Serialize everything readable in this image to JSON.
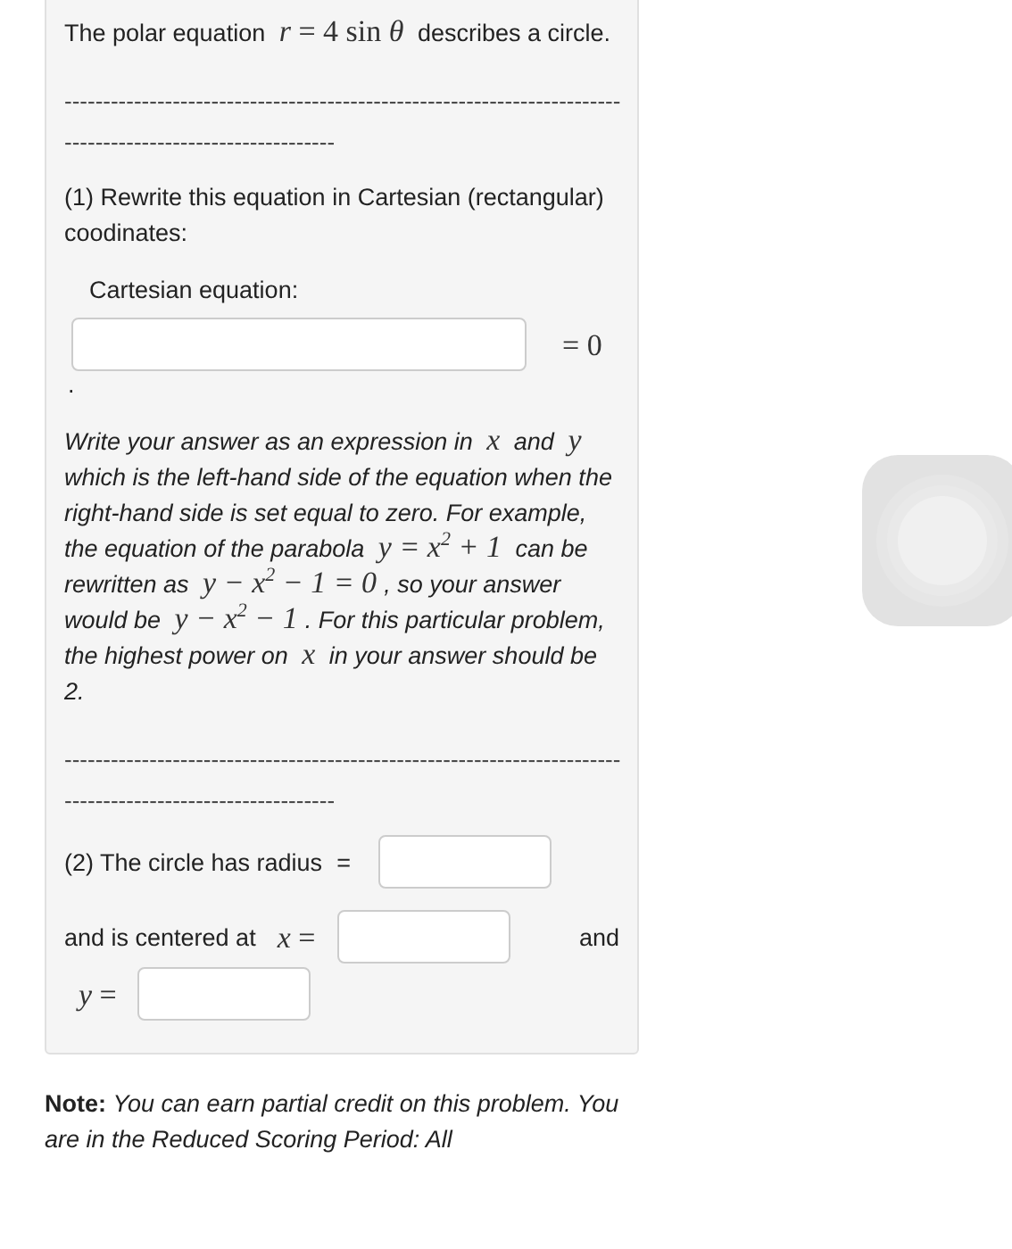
{
  "intro": [
    {
      "kind": "text",
      "text": "The polar equation "
    },
    {
      "kind": "math",
      "text": "*r* = 4 sin *θ*"
    },
    {
      "kind": "text",
      "text": " describes a circle."
    }
  ],
  "rule_1": "-----------------------------------------------------------------------------------------------------------",
  "part_1": {
    "prompt": "(1) Rewrite this equation in Cartesian (rectangular) coodinates:",
    "field_label": "Cartesian equation:",
    "suffix": "= 0",
    "period": "."
  },
  "instructions": [
    {
      "kind": "text",
      "text": "Write your answer as an expression in "
    },
    {
      "kind": "math",
      "text": "*x*"
    },
    {
      "kind": "text",
      "text": " and "
    },
    {
      "kind": "math",
      "text": "*y*"
    },
    {
      "kind": "text",
      "text": " which is the left-hand side of the equation when the right-hand side is set equal to zero. For example, the equation of the parabola "
    },
    {
      "kind": "math",
      "text": "*y* = *x*$^{2}$ + 1"
    },
    {
      "kind": "text",
      "text": " can be rewritten as "
    },
    {
      "kind": "math",
      "text": "*y* − *x*$^{2}$ − 1 = 0"
    },
    {
      "kind": "text",
      "text": ", so your answer would be "
    },
    {
      "kind": "math",
      "text": "*y* − *x*$^{2}$ − 1"
    },
    {
      "kind": "text",
      "text": ". For this particular problem, the highest power on "
    },
    {
      "kind": "math",
      "text": "*x*"
    },
    {
      "kind": "text",
      "text": " in your answer should be 2."
    }
  ],
  "rule_2": "-----------------------------------------------------------------------------------------------------------",
  "part_2": {
    "radius_label": "(2) The circle has radius",
    "radius_equals": "=",
    "center_label": "and is centered at",
    "x_equals": "*x* =",
    "and": "and",
    "y_equals": "*y* ="
  },
  "note": "**Note:** *You can earn partial credit on this problem. You are in the Reduced Scoring Period: All*"
}
